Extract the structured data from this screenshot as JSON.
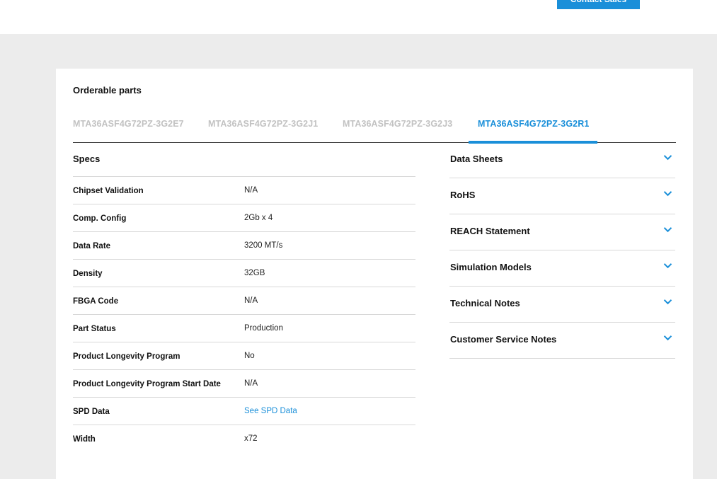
{
  "header": {
    "contact_sales_label": "Contact Sales"
  },
  "orderable": {
    "title": "Orderable parts",
    "tabs": [
      {
        "label": "MTA36ASF4G72PZ-3G2E7",
        "active": false
      },
      {
        "label": "MTA36ASF4G72PZ-3G2J1",
        "active": false
      },
      {
        "label": "MTA36ASF4G72PZ-3G2J3",
        "active": false
      },
      {
        "label": "MTA36ASF4G72PZ-3G2R1",
        "active": true
      }
    ]
  },
  "specs": {
    "title": "Specs",
    "rows": [
      {
        "label": "Chipset Validation",
        "value": "N/A"
      },
      {
        "label": "Comp. Config",
        "value": "2Gb x 4"
      },
      {
        "label": "Data Rate",
        "value": "3200 MT/s"
      },
      {
        "label": "Density",
        "value": "32GB"
      },
      {
        "label": "FBGA Code",
        "value": "N/A"
      },
      {
        "label": "Part Status",
        "value": "Production"
      },
      {
        "label": "Product Longevity Program",
        "value": "No"
      },
      {
        "label": "Product Longevity Program Start Date",
        "value": "N/A"
      },
      {
        "label": "SPD Data",
        "value": "See SPD Data",
        "is_link": true
      },
      {
        "label": "Width",
        "value": "x72"
      }
    ]
  },
  "resources": {
    "items": [
      {
        "label": "Data Sheets",
        "icon": "chevron-down-icon"
      },
      {
        "label": "RoHS",
        "icon": "chevron-down-icon"
      },
      {
        "label": "REACH Statement",
        "icon": "chevron-down-icon"
      },
      {
        "label": "Simulation Models",
        "icon": "chevron-down-icon"
      },
      {
        "label": "Technical Notes",
        "icon": "chevron-down-icon"
      },
      {
        "label": "Customer Service Notes",
        "icon": "chevron-down-icon"
      }
    ]
  },
  "colors": {
    "accent": "#1a8fd9",
    "inactive_tab": "#c2c2c2",
    "page_bg": "#ececec"
  }
}
